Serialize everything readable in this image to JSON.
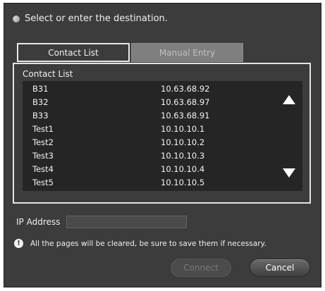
{
  "instruction": "Select or enter the destination.",
  "tabs": {
    "contact_list": "Contact List",
    "manual_entry": "Manual Entry",
    "active": "contact_list"
  },
  "list": {
    "title": "Contact List",
    "rows": [
      {
        "name": "B31",
        "ip": "10.63.68.92"
      },
      {
        "name": "B32",
        "ip": "10.63.68.97"
      },
      {
        "name": "B33",
        "ip": "10.63.68.91"
      },
      {
        "name": "Test1",
        "ip": "10.10.10.1"
      },
      {
        "name": "Test2",
        "ip": "10.10.10.2"
      },
      {
        "name": "Test3",
        "ip": "10.10.10.3"
      },
      {
        "name": "Test4",
        "ip": "10.10.10.4"
      },
      {
        "name": "Test5",
        "ip": "10.10.10.5"
      }
    ],
    "scroll_up_icon": "triangle-up-icon",
    "scroll_down_icon": "triangle-down-icon"
  },
  "ip_address": {
    "label": "IP Address",
    "value": ""
  },
  "warning": {
    "icon": "exclamation-icon",
    "text": "All the pages will be cleared, be sure to save them if necessary."
  },
  "buttons": {
    "connect": "Connect",
    "connect_enabled": false,
    "cancel": "Cancel"
  },
  "colors": {
    "dialog_bg": "#3c3c3c",
    "list_bg": "#252525",
    "text": "#f2f2f2",
    "disabled_text": "#787878"
  }
}
